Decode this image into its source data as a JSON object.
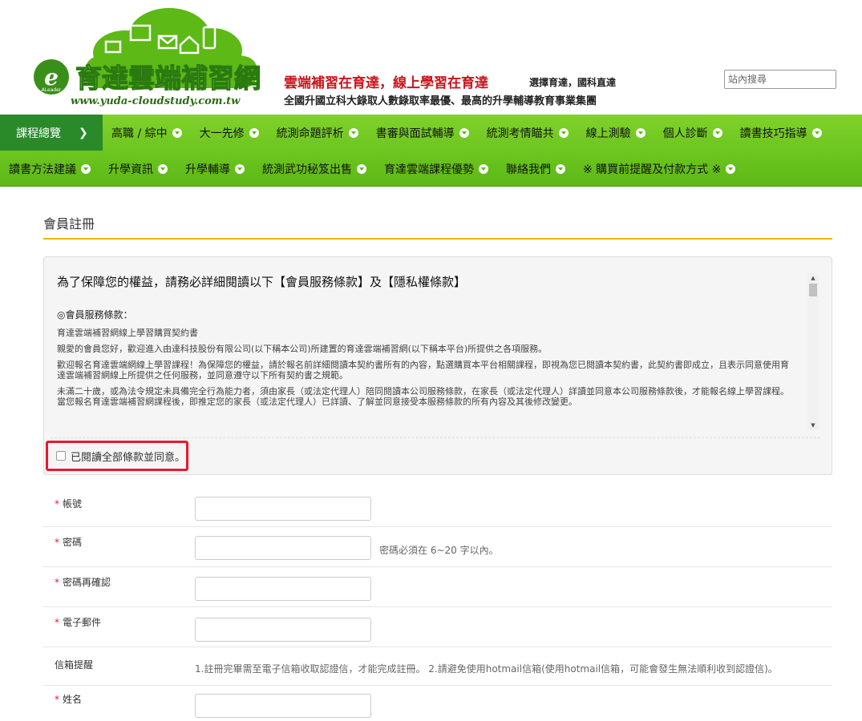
{
  "header": {
    "logo": {
      "brand": "育達雲端補習網",
      "url_text": "www.yuda-cloudstudy.com.tw",
      "small_mark": "ALeader"
    },
    "tagline_main": "雲端補習在育達，線上學習在育達",
    "tagline_right": "選擇育達，國科直達",
    "tagline_sub": "全國升國立科大錄取人數錄取率最優、最高的升學輔導教育事業集團",
    "search_placeholder": "站內搜尋",
    "colors": {
      "tagline": "#c8161d",
      "logo_green": "#5cb916"
    }
  },
  "nav": {
    "overview_label": "課程總覽",
    "row1": [
      "高職 / 綜中",
      "大一先修",
      "統測命題評析",
      "書審與面試輔導",
      "統測考情瞄共",
      "線上測驗",
      "個人診斷",
      "讀書技巧指導"
    ],
    "row2": [
      "讀書方法建議",
      "升學資訊",
      "升學輔導",
      "統測武功秘笈出售",
      "育達雲端課程優勢",
      "聯絡我們",
      "※ 購買前提醒及付款方式 ※"
    ],
    "colors": {
      "bar": "#5cb916",
      "active": "#2a8a2a"
    }
  },
  "page": {
    "title": "會員註冊",
    "rule_color": "#f0b400"
  },
  "terms": {
    "heading": "為了保障您的權益，請務必詳細閱讀以下【會員服務條款】及【隱私權條款】",
    "section_title": "◎會員服務條款：",
    "paragraphs": [
      "育達雲端補習網線上學習購買契約書",
      "親愛的會員您好，歡迎進入由達科技股份有限公司(以下稱本公司)所建置的育達雲端補習網(以下稱本平台)所提供之各項服務。",
      "歡迎報名育達雲端網線上學習課程！為保障您的權益，請於報名前詳細閱讀本契約書所有的內容，點選購買本平台相關課程，即視為您已閱讀本契約書，此契約書即成立，且表示同意使用育達雲端補習網線上所提供之任何服務，並同意遵守以下所有契約書之規範。",
      "未滿二十歲，或為法令規定未具備完全行為能力者，須由家長（或法定代理人）陪同閱讀本公司服務條款，在家長（或法定代理人）詳讀並同意本公司服務條款後，才能報名線上學習課程。當您報名育達雲端補習網課程後，即推定您的家長（或法定代理人）已詳讀、了解並同意接受本服務條款的所有內容及其後修改變更。"
    ],
    "agree_label": "已閱讀全部條款並同意。",
    "highlight_color": "#e8192c"
  },
  "form": {
    "account_label": "帳號",
    "password_label": "密碼",
    "password_hint": "密碼必須在 6~20 字以內。",
    "password_confirm_label": "密碼再確認",
    "email_label": "電子郵件",
    "mailbox_reminder_label": "信箱提醒",
    "mailbox_reminder_text": "1.註冊完畢需至電子信箱收取認證信，才能完成註冊。 2.請避免使用hotmail信箱(使用hotmail信箱，可能會發生無法順利收到認證信)。",
    "name_label": "姓名",
    "required_mark": "*"
  }
}
